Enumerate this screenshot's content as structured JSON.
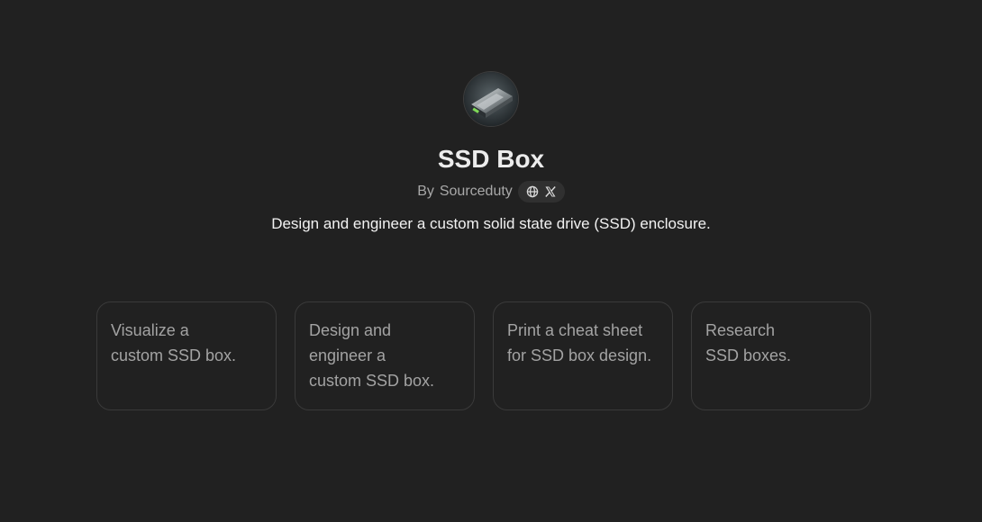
{
  "gpt": {
    "name": "SSD Box",
    "author_prefix": "By",
    "author": "Sourceduty",
    "description": "Design and engineer a custom solid state drive (SSD) enclosure.",
    "avatar_icon": "ssd-enclosure-icon",
    "social_icons": [
      "globe-icon",
      "x-logo-icon"
    ]
  },
  "conversation_starters": [
    {
      "lines": [
        "Visualize a",
        "custom SSD box."
      ]
    },
    {
      "lines": [
        "Design and",
        "engineer a",
        "custom SSD box."
      ]
    },
    {
      "lines": [
        "Print a cheat sheet",
        "for SSD box design."
      ]
    },
    {
      "lines": [
        "Research",
        "SSD boxes."
      ]
    }
  ],
  "colors": {
    "background": "#212121",
    "pill": "#303030",
    "card_border": "#3a3a3a"
  }
}
